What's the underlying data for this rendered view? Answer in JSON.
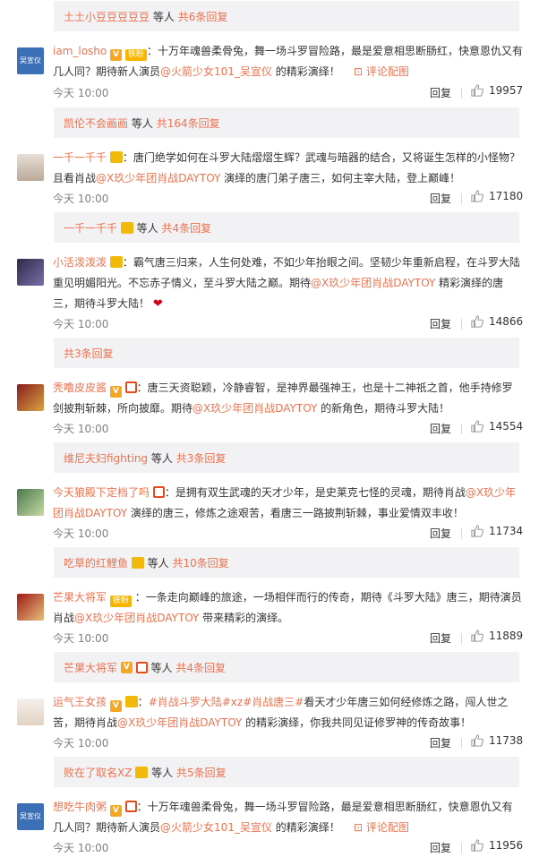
{
  "colors": {
    "accent": "#eb7350",
    "meta": "#808080",
    "bar": "#f2f2f5"
  },
  "icons": {
    "like": "thumbs-up-icon",
    "pic": "image-icon",
    "heart": "heart-icon"
  },
  "threads": [
    {
      "reply_bar": {
        "user": "土土小豆豆豆豆豆",
        "mid": "等人",
        "count": "共6条回复"
      }
    },
    {
      "comment": {
        "user": "iam_losho",
        "avatar_text": "吴宣仪",
        "badges": [
          "v",
          "fan"
        ],
        "fan_label": "铁粉",
        "text_pre": "：十万年魂兽柔骨兔，舞一场斗罗冒险路，最是爱意相思断肠红，快意恩仇又有几人同？期待新人演员",
        "mention": "@火箭少女101_吴宣仪",
        "text_post": " 的精彩演绎！",
        "pic_label": "评论配图",
        "time": "今天 10:00",
        "reply": "回复",
        "likes": "19957"
      },
      "reply_bar": {
        "user": "凯伦不会画画",
        "mid": "等人",
        "count": "共164条回复"
      }
    },
    {
      "comment": {
        "user": "一千一千千",
        "text_pre": "：唐门绝学如何在斗罗大陆熠熠生辉？武魂与暗器的结合，又将诞生怎样的小怪物？且看肖战",
        "mention": "@X玖少年团肖战DAYTOY",
        "text_post": " 演绎的唐门弟子唐三，如何主宰大陆，登上巅峰！",
        "time": "今天 10:00",
        "reply": "回复",
        "likes": "17180"
      },
      "reply_bar": {
        "user": "一千一千千",
        "mid": "等人",
        "count": "共4条回复"
      }
    },
    {
      "comment": {
        "user": "小活泼泼泼",
        "text_pre": "：霸气唐三归来，人生何处难，不如少年抬眼之间。坚韧少年重新启程，在斗罗大陆重见明媚阳光。不忘赤子情义，至斗罗大陆之巅。期待",
        "mention": "@X玖少年团肖战DAYTOY",
        "text_post": " 精彩演绎的唐三，期待斗罗大陆！",
        "time": "今天 10:00",
        "reply": "回复",
        "likes": "14866"
      },
      "reply_bar": {
        "user": "",
        "mid": "",
        "count": "共3条回复"
      }
    },
    {
      "comment": {
        "user": "秃噜皮皮酱",
        "text_pre": "：唐三天资聪颖，冷静睿智，是神界最强神王，也是十二神祇之首，他手持修罗剑披荆斩棘，所向披靡。期待",
        "mention": "@X玖少年团肖战DAYTOY",
        "text_post": " 的新角色，期待斗罗大陆！",
        "time": "今天 10:00",
        "reply": "回复",
        "likes": "14554"
      },
      "reply_bar": {
        "user": "维尼夫妇fighting",
        "mid": "等人",
        "count": "共3条回复"
      }
    },
    {
      "comment": {
        "user": "今天狼殿下定档了吗",
        "text_pre": "：是拥有双生武魂的天才少年，是史莱克七怪的灵魂，期待肖战",
        "mention": "@X玖少年团肖战DAYTOY",
        "text_post": " 演绎的唐三，修炼之途艰苦，看唐三一路披荆斩棘，事业爱情双丰收！",
        "time": "今天 10:00",
        "reply": "回复",
        "likes": "11734"
      },
      "reply_bar": {
        "user": "吃草的红鲤鱼",
        "mid": "等人",
        "count": "共10条回复"
      }
    },
    {
      "comment": {
        "user": "芒果大将军",
        "fan_label": "铁粉",
        "text_pre": "：一条走向巅峰的旅途，一场相伴而行的传奇，期待《斗罗大陆》唐三，期待演员肖战",
        "mention": "@X玖少年团肖战DAYTOY",
        "text_post": " 带来精彩的演绎。",
        "time": "今天 10:00",
        "reply": "回复",
        "likes": "11889"
      },
      "reply_bar": {
        "user": "芒果大将军",
        "mid": "等人",
        "count": "共4条回复"
      }
    },
    {
      "comment": {
        "user": "运气王女孩",
        "text_pre": "：",
        "tags": "#肖战斗罗大陆#xz#肖战唐三#",
        "text_mid": "看天才少年唐三如何经修炼之路，闯人世之苦，期待肖战",
        "mention": "@X玖少年团肖战DAYTOY",
        "text_post": " 的精彩演绎，你我共同见证修罗神的传奇故事！",
        "time": "今天 10:00",
        "reply": "回复",
        "likes": "11738"
      },
      "reply_bar": {
        "user": "败在了取名XZ",
        "mid": "等人",
        "count": "共5条回复"
      }
    },
    {
      "comment": {
        "user": "想吃牛肉粥",
        "avatar_text": "吴宣仪",
        "text_pre": "：十万年魂兽柔骨兔，舞一场斗罗冒险路，最是爱意相思断肠红，快意恩仇又有几人同？期待新人演员",
        "mention": "@火箭少女101_吴宣仪",
        "text_post": " 的精彩演绎！",
        "pic_label": "评论配图",
        "time": "今天 10:00",
        "reply": "回复",
        "likes": "11956"
      }
    }
  ]
}
